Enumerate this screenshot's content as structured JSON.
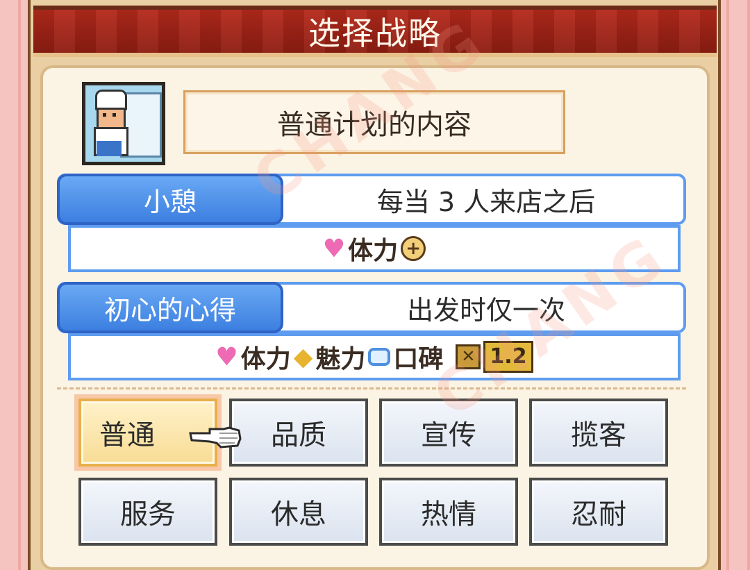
{
  "title": "选择战略",
  "plan_title": "普通计划的内容",
  "strategies": [
    {
      "name": "小憩",
      "condition": "每当 3 人来店之后",
      "effect": {
        "stat1": "体力",
        "icons": [
          "heart-icon",
          "plus-icon"
        ]
      }
    },
    {
      "name": "初心的心得",
      "condition": "出发时仅一次",
      "effect": {
        "stat1": "体力",
        "stat2": "魅力",
        "stat3": "口碑",
        "multiplier": "1.2",
        "icons": [
          "heart-icon",
          "charm-icon",
          "speech-icon",
          "times-icon"
        ]
      }
    }
  ],
  "buttons": {
    "row1": [
      "普通",
      "品质",
      "宣传",
      "揽客"
    ],
    "row2": [
      "服务",
      "休息",
      "热情",
      "忍耐"
    ],
    "selected": "普通"
  },
  "colors": {
    "title_bar": "#a02418",
    "strategy_blue": "#4a8fe8",
    "selected_button": "#f7dc94"
  }
}
